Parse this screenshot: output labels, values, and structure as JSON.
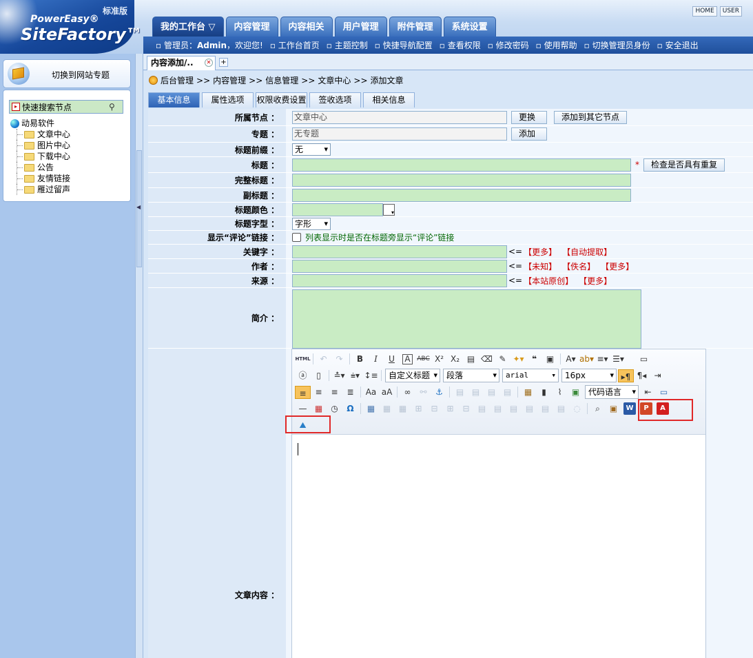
{
  "header": {
    "logo_line1": "PowerEasy®",
    "logo_line2": "SiteFactory™",
    "edition": "标准版",
    "toplinks": [
      "HOME",
      "USER"
    ],
    "main_tabs": [
      "我的工作台 ▽",
      "内容管理",
      "内容相关",
      "用户管理",
      "附件管理",
      "系统设置"
    ],
    "admin_prefix": "管理员：",
    "admin_name": "Admin",
    "admin_suffix": "，欢迎您!",
    "subnav": [
      "工作台首页",
      "主题控制",
      "快捷导航配置",
      "查看权限",
      "修改密码",
      "使用帮助",
      "切换管理员身份",
      "安全退出"
    ]
  },
  "sidebar": {
    "switch_label": "切换到网站专题",
    "search_placeholder": "快速搜索节点",
    "tree_root": "动易软件",
    "tree_items": [
      "文章中心",
      "图片中心",
      "下载中心",
      "公告",
      "友情链接",
      "雁过留声"
    ]
  },
  "main": {
    "doc_tab": "内容添加/..",
    "breadcrumb": [
      "后台管理",
      ">>",
      "内容管理",
      ">>",
      "信息管理",
      ">>",
      "文章中心",
      ">>",
      "添加文章"
    ],
    "form_tabs": [
      "基本信息",
      "属性选项",
      "权限收费设置",
      "签收选项",
      "相关信息"
    ]
  },
  "form": {
    "node_label": "所属节点 ：",
    "node_value": "文章中心",
    "change_btn": "更换",
    "add_other_btn": "添加到其它节点",
    "topic_label": "专题 ：",
    "topic_value": "无专题",
    "add_btn": "添加",
    "prefix_label": "标题前缀 ：",
    "prefix_value": "无",
    "title_label": "标题 ：",
    "required_mark": "*",
    "check_dup_btn": "检查是否具有重复",
    "full_title_label": "完整标题 ：",
    "subtitle_label": "副标题 ：",
    "title_color_label": "标题颜色 ：",
    "title_style_label": "标题字型 ：",
    "title_style_value": "字形",
    "comment_label": "显示“评论”链接 ：",
    "comment_text": "列表显示时是否在标题旁显示“评论”链接",
    "keyword_label": "关键字 ：",
    "keyword_links": [
      "<=",
      "【更多】",
      "【自动提取】"
    ],
    "author_label": "作者 ：",
    "author_links": [
      "<=",
      "【未知】",
      "【佚名】",
      "【更多】"
    ],
    "source_label": "来源 ：",
    "source_links": [
      "<=",
      "【本站原创】",
      "【更多】"
    ],
    "intro_label": "简介 ：",
    "content_label": "文章内容 ："
  },
  "editor": {
    "html_icon": "HTML",
    "custom_title": "自定义标题",
    "paragraph": "段落",
    "font": "arial",
    "size": "16px",
    "code_lang": "代码语言",
    "office_icons": [
      "W",
      "P",
      "A"
    ]
  }
}
